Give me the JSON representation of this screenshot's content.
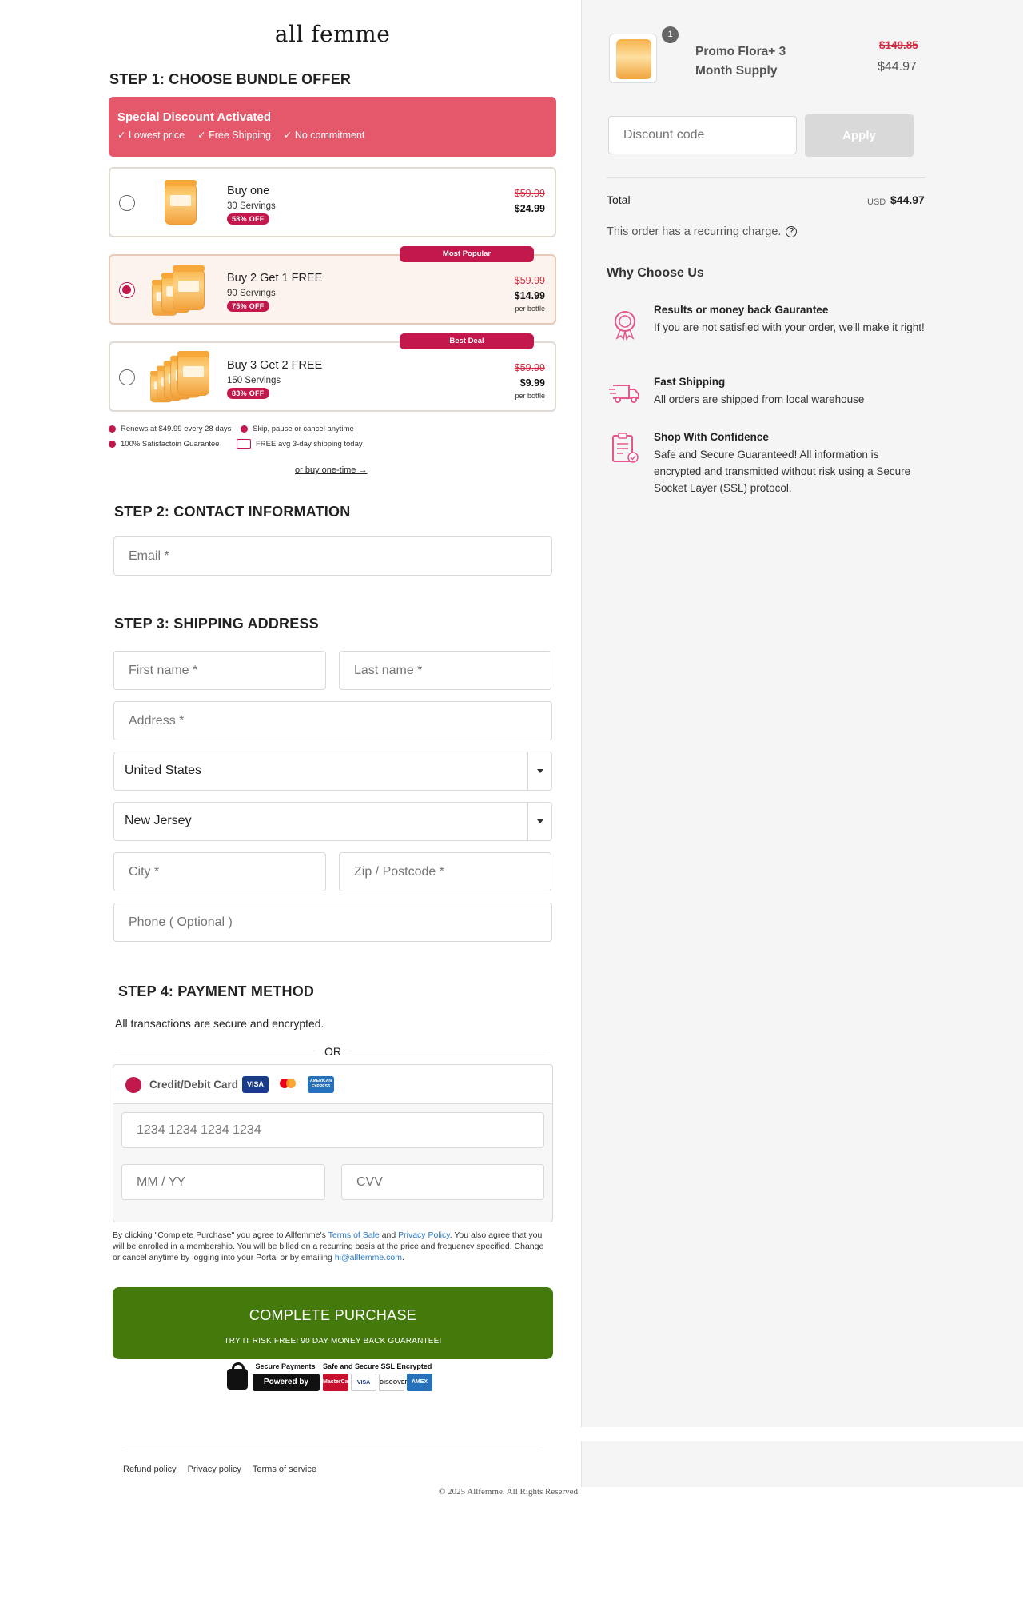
{
  "brand": {
    "logo": "all femme"
  },
  "step1": {
    "title": "STEP 1: CHOOSE BUNDLE OFFER",
    "banner": {
      "title": "Special Discount Activated",
      "items": [
        "✓ Lowest price",
        "✓ Free Shipping",
        "✓ No commitment"
      ]
    },
    "offers": [
      {
        "name": "Buy one",
        "servings": "30 Servings",
        "off": "58% OFF",
        "old": "$59.99",
        "new": "$24.99",
        "per": "",
        "tag": "",
        "selected": false
      },
      {
        "name": "Buy 2 Get 1 FREE",
        "servings": "90 Servings",
        "off": "75% OFF",
        "old": "$59.99",
        "new": "$14.99",
        "per": "per bottle",
        "tag": "Most Popular",
        "selected": true
      },
      {
        "name": "Buy 3 Get 2 FREE",
        "servings": "150 Servings",
        "off": "83% OFF",
        "old": "$59.99",
        "new": "$9.99",
        "per": "per bottle",
        "tag": "Best Deal",
        "selected": false
      }
    ],
    "perks": [
      "Renews at $49.99 every 28 days",
      "Skip, pause or cancel anytime",
      "100% Satisfactoin Guarantee",
      "FREE avg 3-day shipping today"
    ],
    "one_time": "or buy one-time →"
  },
  "step2": {
    "title": "STEP 2: CONTACT INFORMATION",
    "email_placeholder": "Email *"
  },
  "step3": {
    "title": "STEP 3: SHIPPING ADDRESS",
    "first_name": "First name *",
    "last_name": "Last name *",
    "address": "Address *",
    "country": "United States",
    "state": "New Jersey",
    "city": "City *",
    "zip": "Zip / Postcode *",
    "phone": "Phone ( Optional )"
  },
  "step4": {
    "title": "STEP 4: PAYMENT METHOD",
    "secure_note": "All transactions are secure and encrypted.",
    "or": "OR",
    "method_label": "Credit/Debit Card",
    "cards": [
      "VISA",
      "mastercard",
      "AMERICAN EXPRESS"
    ],
    "card_number": "1234 1234 1234 1234",
    "expiry": "MM / YY",
    "cvv": "CVV",
    "legal_pre": "By clicking \"Complete Purchase\" you agree to Allfemme's ",
    "terms_link": "Terms of Sale",
    "legal_and": " and ",
    "privacy_link": "Privacy Policy",
    "legal_post": ". You also agree that you will be enrolled in a membership. You will be billed on a recurring basis at the price and frequency specified. Change or cancel anytime by logging into your Portal or by emailing ",
    "email_link": "hi@allfemme.com",
    "legal_end": ".",
    "purchase_label": "COMPLETE PURCHASE",
    "purchase_sub": "TRY IT RISK FREE! 90 DAY MONEY BACK GUARANTEE!",
    "badge_secure": "Secure Payments",
    "badge_ssl": "Safe and Secure SSL Encrypted",
    "badge_stripe": "Powered by stripe",
    "badge_cards": [
      "MasterCard",
      "VISA",
      "DISCOVER",
      "AMEX"
    ]
  },
  "footer": {
    "links": [
      "Refund policy",
      "Privacy policy",
      "Terms of service"
    ],
    "copyright": "© 2025 Allfemme. All Rights Reserved."
  },
  "summary": {
    "qty": "1",
    "product": "Promo Flora+ 3 Month Supply",
    "old_price": "$149.85",
    "price": "$44.97",
    "discount_placeholder": "Discount code",
    "apply": "Apply",
    "total_label": "Total",
    "currency": "USD",
    "total": "$44.97",
    "recurring": "This order has a recurring charge.",
    "why_title": "Why Choose Us",
    "features": [
      {
        "icon": "award-ribbon-icon",
        "title": "Results or money back Gaurantee",
        "desc": "If you are not satisfied with your order, we'll make it right!"
      },
      {
        "icon": "delivery-truck-icon",
        "title": "Fast Shipping",
        "desc": "All orders are shipped from local warehouse"
      },
      {
        "icon": "clipboard-check-icon",
        "title": "Shop With Confidence",
        "desc": "Safe and Secure Guaranteed! All information is encrypted and transmitted without risk using a Secure Socket Layer (SSL) protocol."
      }
    ]
  },
  "colors": {
    "accent": "#c2184b",
    "banner": "#e5586b",
    "purchase": "#437a0b",
    "panel": "#f5f5f5"
  }
}
